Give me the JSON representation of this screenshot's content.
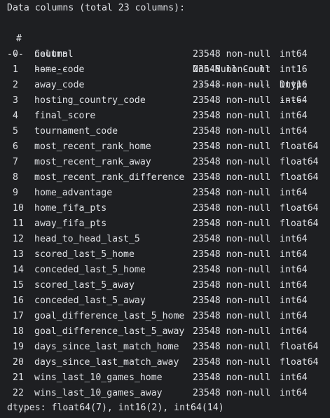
{
  "header": "Data columns (total 23 columns):",
  "columns": {
    "idx": " #",
    "name": "Column",
    "count": "Non-Null Count",
    "dtype": "Dtype"
  },
  "separators": {
    "idx": "---",
    "name": "------",
    "count": "--------------",
    "dtype": "-----"
  },
  "rows": [
    {
      "idx": "0",
      "name": "neutral",
      "count": "23548 non-null",
      "dtype": "int64"
    },
    {
      "idx": "1",
      "name": "home_code",
      "count": "23548 non-null",
      "dtype": "int16"
    },
    {
      "idx": "2",
      "name": "away_code",
      "count": "23548 non-null",
      "dtype": "int16"
    },
    {
      "idx": "3",
      "name": "hosting_country_code",
      "count": "23548 non-null",
      "dtype": "int64"
    },
    {
      "idx": "4",
      "name": "final_score",
      "count": "23548 non-null",
      "dtype": "int64"
    },
    {
      "idx": "5",
      "name": "tournament_code",
      "count": "23548 non-null",
      "dtype": "int64"
    },
    {
      "idx": "6",
      "name": "most_recent_rank_home",
      "count": "23548 non-null",
      "dtype": "float64"
    },
    {
      "idx": "7",
      "name": "most_recent_rank_away",
      "count": "23548 non-null",
      "dtype": "float64"
    },
    {
      "idx": "8",
      "name": "most_recent_rank_difference",
      "count": "23548 non-null",
      "dtype": "float64"
    },
    {
      "idx": "9",
      "name": "home_advantage",
      "count": "23548 non-null",
      "dtype": "int64"
    },
    {
      "idx": "10",
      "name": "home_fifa_pts",
      "count": "23548 non-null",
      "dtype": "float64"
    },
    {
      "idx": "11",
      "name": "away_fifa_pts",
      "count": "23548 non-null",
      "dtype": "float64"
    },
    {
      "idx": "12",
      "name": "head_to_head_last_5",
      "count": "23548 non-null",
      "dtype": "int64"
    },
    {
      "idx": "13",
      "name": "scored_last_5_home",
      "count": "23548 non-null",
      "dtype": "int64"
    },
    {
      "idx": "14",
      "name": "conceded_last_5_home",
      "count": "23548 non-null",
      "dtype": "int64"
    },
    {
      "idx": "15",
      "name": "scored_last_5_away",
      "count": "23548 non-null",
      "dtype": "int64"
    },
    {
      "idx": "16",
      "name": "conceded_last_5_away",
      "count": "23548 non-null",
      "dtype": "int64"
    },
    {
      "idx": "17",
      "name": "goal_difference_last_5_home",
      "count": "23548 non-null",
      "dtype": "int64"
    },
    {
      "idx": "18",
      "name": "goal_difference_last_5_away",
      "count": "23548 non-null",
      "dtype": "int64"
    },
    {
      "idx": "19",
      "name": "days_since_last_match_home",
      "count": "23548 non-null",
      "dtype": "float64"
    },
    {
      "idx": "20",
      "name": "days_since_last_match_away",
      "count": "23548 non-null",
      "dtype": "float64"
    },
    {
      "idx": "21",
      "name": "wins_last_10_games_home",
      "count": "23548 non-null",
      "dtype": "int64"
    },
    {
      "idx": "22",
      "name": "wins_last_10_games_away",
      "count": "23548 non-null",
      "dtype": "int64"
    }
  ],
  "footer": "dtypes: float64(7), int16(2), int64(14)"
}
